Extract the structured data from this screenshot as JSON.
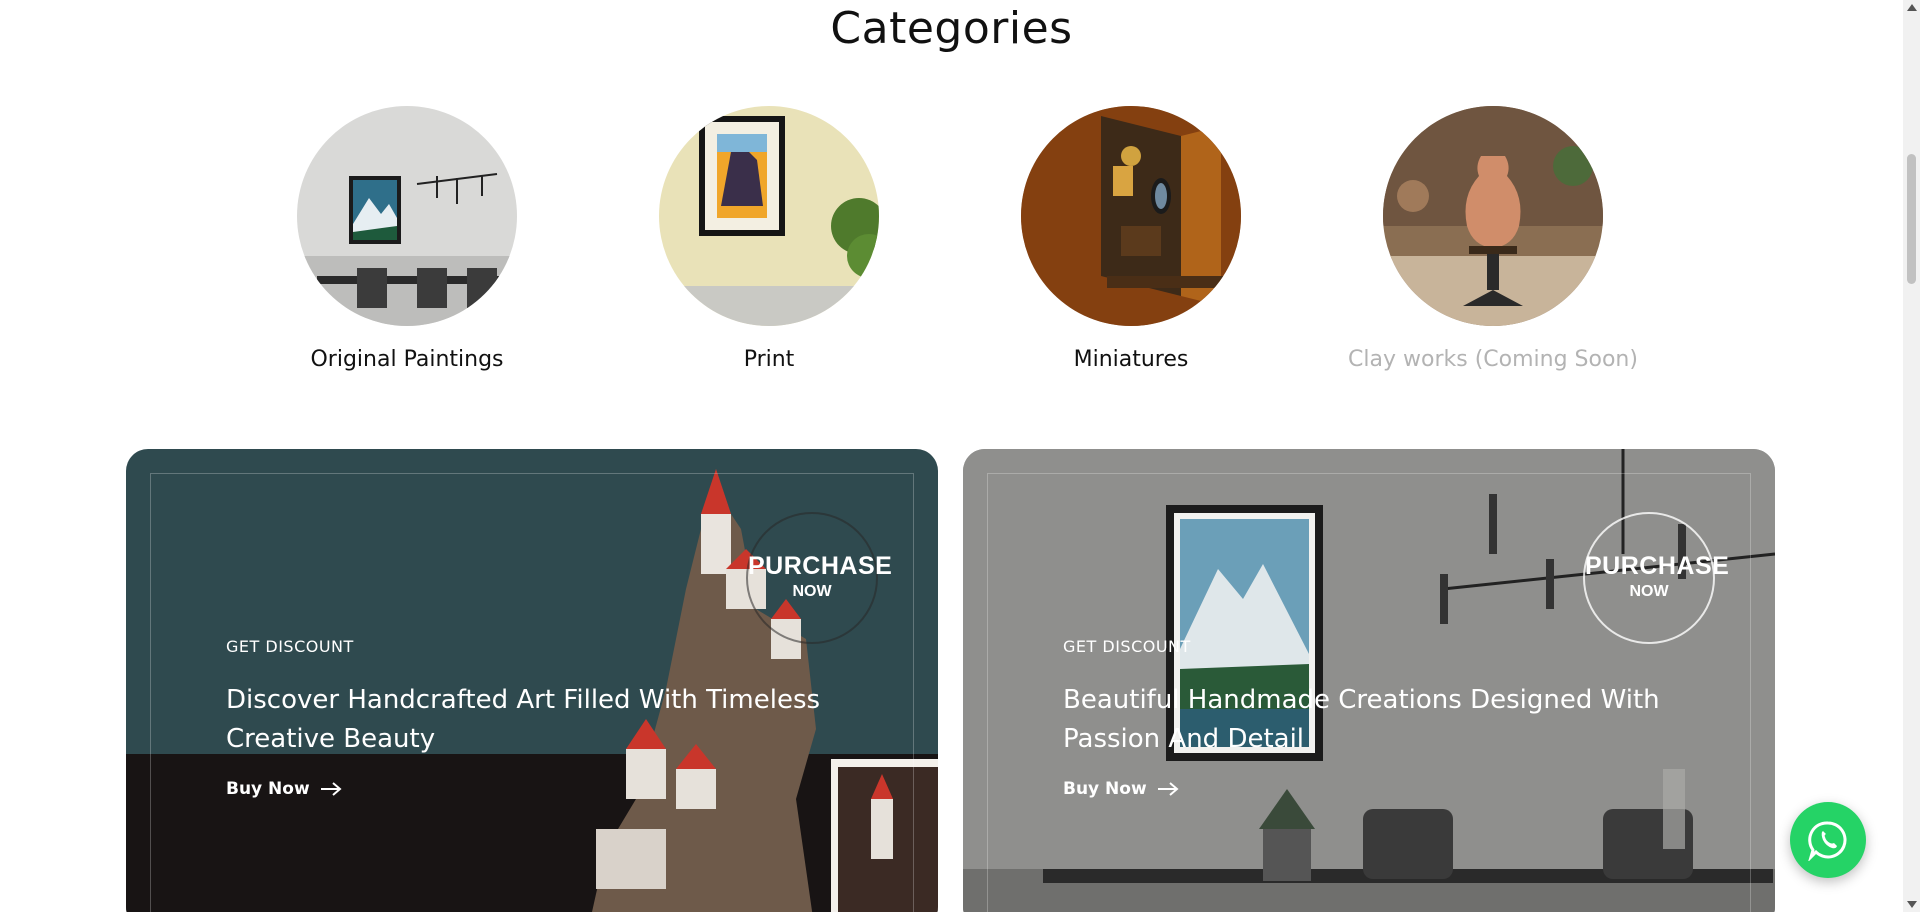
{
  "categories_section": {
    "title": "Categories",
    "items": [
      {
        "label": "Original Paintings",
        "image": "living-room-painting-image",
        "muted": false
      },
      {
        "label": "Print",
        "image": "framed-print-image",
        "muted": false
      },
      {
        "label": "Miniatures",
        "image": "miniature-room-image",
        "muted": false
      },
      {
        "label": "Clay works (Coming Soon)",
        "image": "clay-vase-image",
        "muted": true
      }
    ]
  },
  "promos": [
    {
      "eyebrow": "GET DISCOUNT",
      "headline": "Discover Handcrafted Art Filled With Timeless Creative Beauty",
      "cta": "Buy Now",
      "badge_line1": "PURCHASE",
      "badge_line2": "NOW",
      "bg_color": "#2f4a4f"
    },
    {
      "eyebrow": "GET DISCOUNT",
      "headline": "Beautiful Handmade Creations Designed With Passion And Detail",
      "cta": "Buy Now",
      "badge_line1": "PURCHASE",
      "badge_line2": "NOW",
      "bg_color": "#8c8c8a"
    }
  ],
  "floating": {
    "whatsapp_icon": "whatsapp-icon",
    "color": "#25d366"
  },
  "icons": {
    "arrow": "arrow-right-icon"
  }
}
